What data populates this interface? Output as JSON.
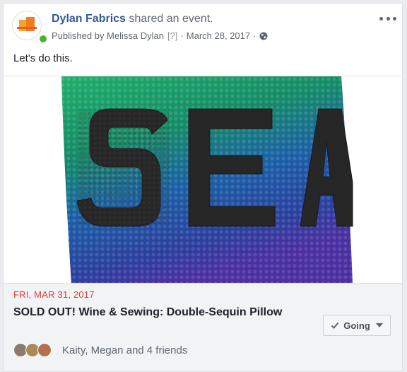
{
  "post": {
    "page_name": "Dylan Fabrics",
    "action_text": "shared an event.",
    "published_by": "Published by Melissa Dylan",
    "help_marker": "[?]",
    "separator": "·",
    "date": "March 28, 2017",
    "privacy_icon": "globe-icon",
    "more_icon": "more-options-icon",
    "text": "Let's do this."
  },
  "photo": {
    "text": "SEA"
  },
  "event": {
    "date": "FRI, MAR 31, 2017",
    "title": "SOLD OUT! Wine & Sewing: Double-Sequin Pillow",
    "rsvp_label": "Going",
    "friends_text": "Kaity, Megan and 4 friends"
  },
  "colors": {
    "link": "#365899",
    "event_date": "#e13a3a",
    "online": "#42b72a"
  }
}
